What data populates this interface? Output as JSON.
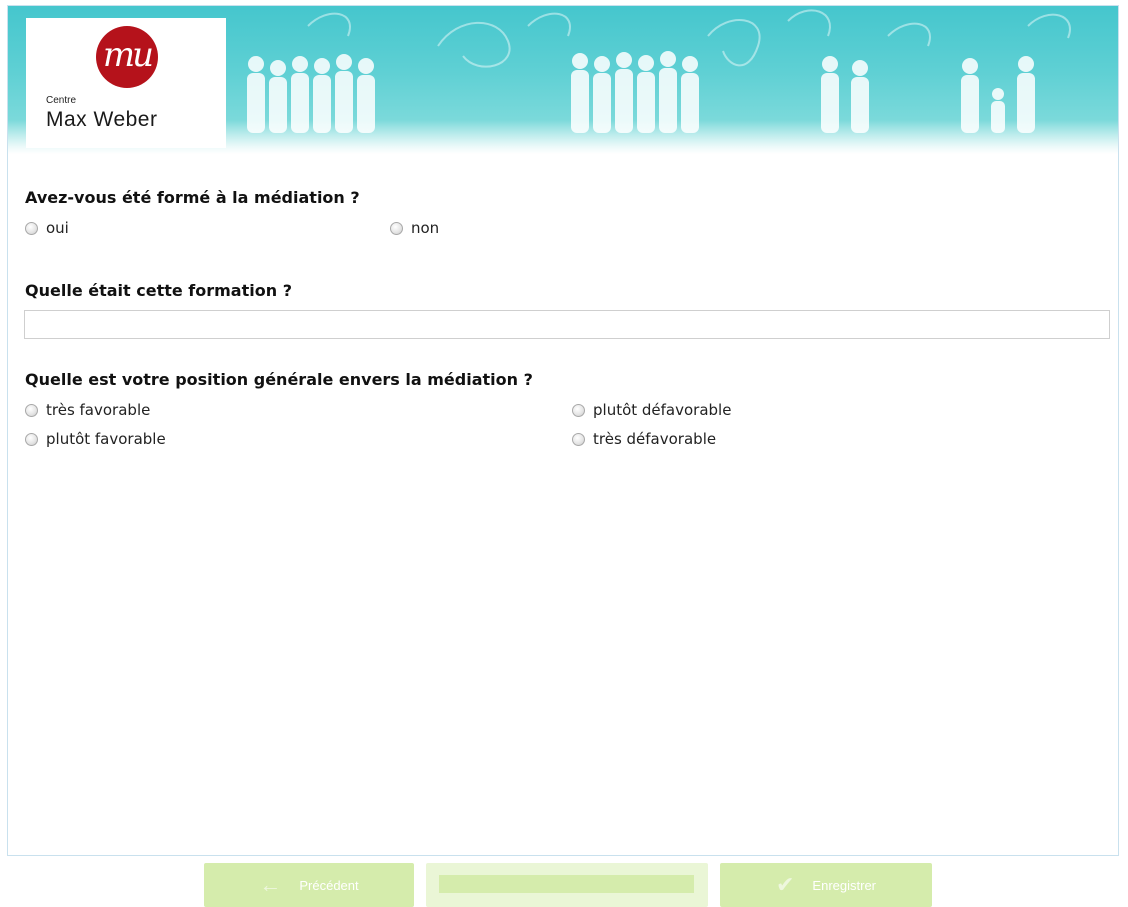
{
  "header": {
    "logo": {
      "mark": "mu",
      "small_label": "Centre",
      "name": "Max Weber"
    }
  },
  "questions": [
    {
      "title": "Avez-vous été formé à la médiation ?",
      "type": "radio",
      "options": [
        "oui",
        "non"
      ],
      "selected": null
    },
    {
      "title": "Quelle était cette formation ?",
      "type": "text",
      "value": "",
      "placeholder": ""
    },
    {
      "title": "Quelle est votre position générale envers la médiation ?",
      "type": "radio",
      "options": [
        "très favorable",
        "plutôt favorable",
        "plutôt défavorable",
        "très défavorable"
      ],
      "selected": null
    }
  ],
  "footer": {
    "prev_label": "Précédent",
    "prev_icon": "arrow-left-icon",
    "save_label": "Enregistrer",
    "save_icon": "checkmark-icon",
    "progress": 0
  },
  "colors": {
    "banner": "#5fd0d4",
    "logo_red": "#b5121b",
    "button_green": "#d5ecac"
  }
}
